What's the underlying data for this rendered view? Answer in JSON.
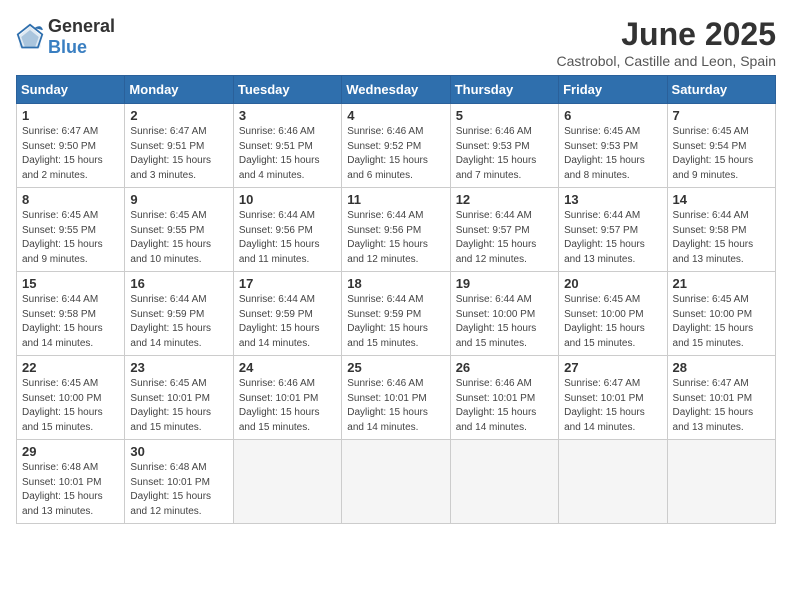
{
  "header": {
    "logo_general": "General",
    "logo_blue": "Blue",
    "title": "June 2025",
    "subtitle": "Castrobol, Castille and Leon, Spain"
  },
  "columns": [
    "Sunday",
    "Monday",
    "Tuesday",
    "Wednesday",
    "Thursday",
    "Friday",
    "Saturday"
  ],
  "weeks": [
    [
      {
        "day": "1",
        "sunrise": "6:47 AM",
        "sunset": "9:50 PM",
        "daylight": "15 hours and 2 minutes."
      },
      {
        "day": "2",
        "sunrise": "6:47 AM",
        "sunset": "9:51 PM",
        "daylight": "15 hours and 3 minutes."
      },
      {
        "day": "3",
        "sunrise": "6:46 AM",
        "sunset": "9:51 PM",
        "daylight": "15 hours and 4 minutes."
      },
      {
        "day": "4",
        "sunrise": "6:46 AM",
        "sunset": "9:52 PM",
        "daylight": "15 hours and 6 minutes."
      },
      {
        "day": "5",
        "sunrise": "6:46 AM",
        "sunset": "9:53 PM",
        "daylight": "15 hours and 7 minutes."
      },
      {
        "day": "6",
        "sunrise": "6:45 AM",
        "sunset": "9:53 PM",
        "daylight": "15 hours and 8 minutes."
      },
      {
        "day": "7",
        "sunrise": "6:45 AM",
        "sunset": "9:54 PM",
        "daylight": "15 hours and 9 minutes."
      }
    ],
    [
      {
        "day": "8",
        "sunrise": "6:45 AM",
        "sunset": "9:55 PM",
        "daylight": "15 hours and 9 minutes."
      },
      {
        "day": "9",
        "sunrise": "6:45 AM",
        "sunset": "9:55 PM",
        "daylight": "15 hours and 10 minutes."
      },
      {
        "day": "10",
        "sunrise": "6:44 AM",
        "sunset": "9:56 PM",
        "daylight": "15 hours and 11 minutes."
      },
      {
        "day": "11",
        "sunrise": "6:44 AM",
        "sunset": "9:56 PM",
        "daylight": "15 hours and 12 minutes."
      },
      {
        "day": "12",
        "sunrise": "6:44 AM",
        "sunset": "9:57 PM",
        "daylight": "15 hours and 12 minutes."
      },
      {
        "day": "13",
        "sunrise": "6:44 AM",
        "sunset": "9:57 PM",
        "daylight": "15 hours and 13 minutes."
      },
      {
        "day": "14",
        "sunrise": "6:44 AM",
        "sunset": "9:58 PM",
        "daylight": "15 hours and 13 minutes."
      }
    ],
    [
      {
        "day": "15",
        "sunrise": "6:44 AM",
        "sunset": "9:58 PM",
        "daylight": "15 hours and 14 minutes."
      },
      {
        "day": "16",
        "sunrise": "6:44 AM",
        "sunset": "9:59 PM",
        "daylight": "15 hours and 14 minutes."
      },
      {
        "day": "17",
        "sunrise": "6:44 AM",
        "sunset": "9:59 PM",
        "daylight": "15 hours and 14 minutes."
      },
      {
        "day": "18",
        "sunrise": "6:44 AM",
        "sunset": "9:59 PM",
        "daylight": "15 hours and 15 minutes."
      },
      {
        "day": "19",
        "sunrise": "6:44 AM",
        "sunset": "10:00 PM",
        "daylight": "15 hours and 15 minutes."
      },
      {
        "day": "20",
        "sunrise": "6:45 AM",
        "sunset": "10:00 PM",
        "daylight": "15 hours and 15 minutes."
      },
      {
        "day": "21",
        "sunrise": "6:45 AM",
        "sunset": "10:00 PM",
        "daylight": "15 hours and 15 minutes."
      }
    ],
    [
      {
        "day": "22",
        "sunrise": "6:45 AM",
        "sunset": "10:00 PM",
        "daylight": "15 hours and 15 minutes."
      },
      {
        "day": "23",
        "sunrise": "6:45 AM",
        "sunset": "10:01 PM",
        "daylight": "15 hours and 15 minutes."
      },
      {
        "day": "24",
        "sunrise": "6:46 AM",
        "sunset": "10:01 PM",
        "daylight": "15 hours and 15 minutes."
      },
      {
        "day": "25",
        "sunrise": "6:46 AM",
        "sunset": "10:01 PM",
        "daylight": "15 hours and 14 minutes."
      },
      {
        "day": "26",
        "sunrise": "6:46 AM",
        "sunset": "10:01 PM",
        "daylight": "15 hours and 14 minutes."
      },
      {
        "day": "27",
        "sunrise": "6:47 AM",
        "sunset": "10:01 PM",
        "daylight": "15 hours and 14 minutes."
      },
      {
        "day": "28",
        "sunrise": "6:47 AM",
        "sunset": "10:01 PM",
        "daylight": "15 hours and 13 minutes."
      }
    ],
    [
      {
        "day": "29",
        "sunrise": "6:48 AM",
        "sunset": "10:01 PM",
        "daylight": "15 hours and 13 minutes."
      },
      {
        "day": "30",
        "sunrise": "6:48 AM",
        "sunset": "10:01 PM",
        "daylight": "15 hours and 12 minutes."
      },
      null,
      null,
      null,
      null,
      null
    ]
  ]
}
